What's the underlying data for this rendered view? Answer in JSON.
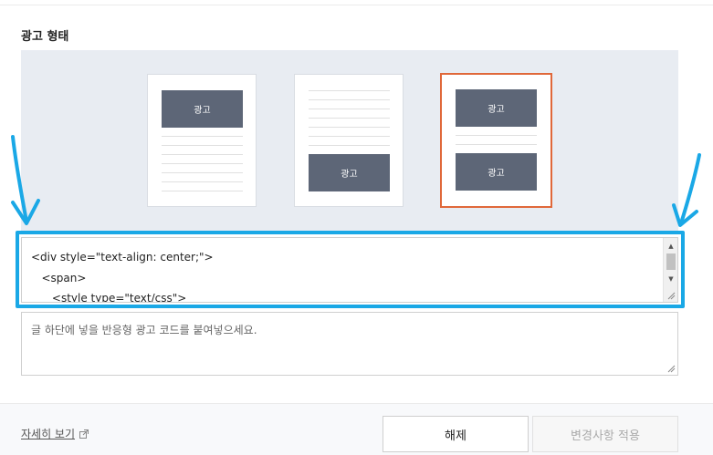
{
  "section": {
    "title": "광고 형태"
  },
  "layouts": {
    "card1": {
      "ad_label": "광고"
    },
    "card2": {
      "ad_label": "광고"
    },
    "card3": {
      "ad_top_label": "광고",
      "ad_bottom_label": "광고",
      "selected": true
    }
  },
  "code_editor": {
    "lines": "<div style=\"text-align: center;\">\n   <span>\n      <style type=\"text/css\">"
  },
  "description": {
    "placeholder": "글 하단에 넣을 반응형 광고 코드를 붙여넣으세요."
  },
  "footer": {
    "detail_link": "자세히 보기",
    "release_button": "해제",
    "apply_button": "변경사항 적용"
  },
  "colors": {
    "highlight": "#1aa8e6",
    "selected_border": "#e0683a",
    "ad_block": "#5d6677"
  }
}
